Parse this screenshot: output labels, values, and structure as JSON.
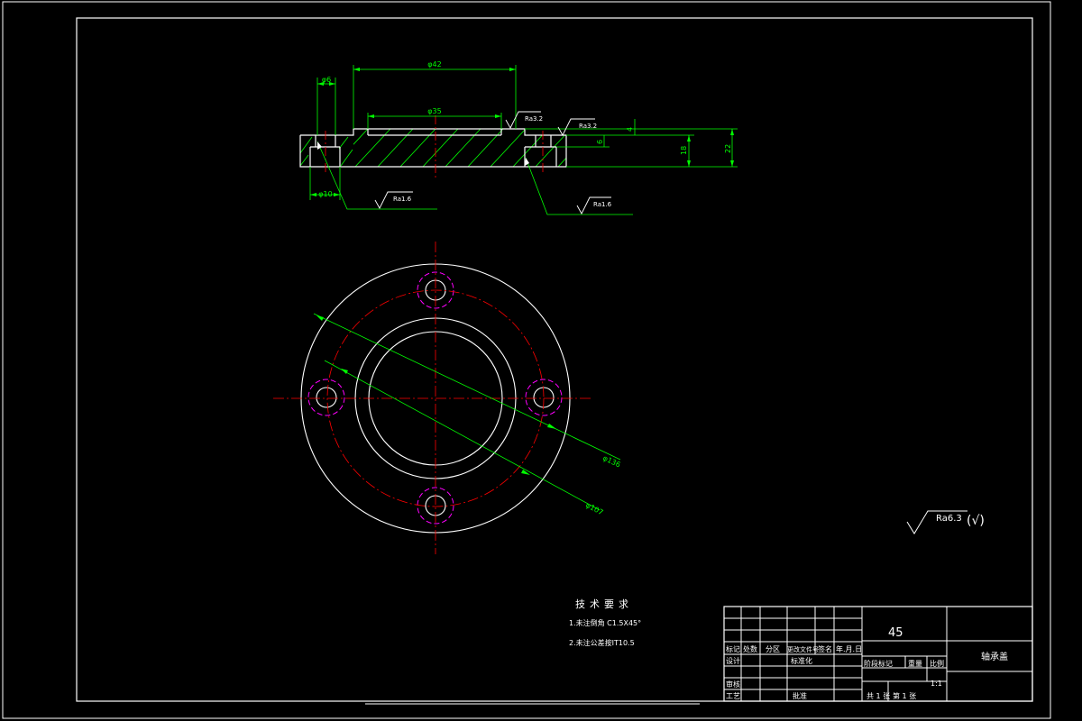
{
  "colors": {
    "background": "#000000",
    "outline": "#ffffff",
    "dimension": "#00ff00",
    "centerline": "#ff0000",
    "hole_center_circle": "#ff00ff"
  },
  "section_view": {
    "dimensions": {
      "d42": "φ42",
      "d35": "φ35",
      "d6": "φ6",
      "d10": "φ10",
      "h4": "4",
      "h6": "6",
      "h18": "18",
      "h22": "22"
    },
    "roughness": {
      "top_inner": "Ra3.2",
      "top_right": "Ra3.2",
      "bottom_left": "Ra1.6",
      "bottom_right": "Ra1.6"
    }
  },
  "plan_view": {
    "diameters": {
      "outer": "φ136",
      "bolt_circle": "φ107"
    }
  },
  "surface_default": {
    "label": "Ra6.3",
    "suffix": "(√)"
  },
  "tech_requirements": {
    "title": "技术要求",
    "line1": "1.未注倒角 C1.5X45°",
    "line2": "2.未注公差按IT10.5"
  },
  "title_block": {
    "material": "45",
    "part_name": "轴承盖",
    "scale_label": "比例",
    "scale_value": "1:1",
    "weight_label": "重量",
    "stage_label": "阶段标记",
    "sheets_total": "共 1 张",
    "sheet_number": "第 1 张",
    "head_mark": "标记",
    "head_count": "处数",
    "head_zone": "分区",
    "head_doc": "更改文件号",
    "head_sign": "签名",
    "head_date": "年.月.日",
    "designer": "设计",
    "standardize": "标准化",
    "checker": "审核",
    "process": "工艺",
    "approve": "批准"
  }
}
